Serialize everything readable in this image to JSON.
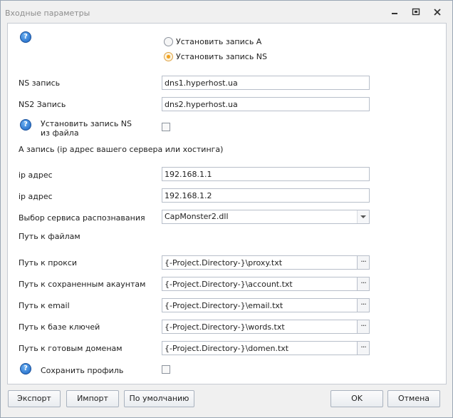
{
  "window": {
    "title": "Входные параметры"
  },
  "record_type": {
    "options": [
      "Установить запись А",
      "Установить запись NS"
    ],
    "selected_index": 1
  },
  "fields": {
    "ns_label": "NS запись",
    "ns_value": "dns1.hyperhost.ua",
    "ns2_label": "NS2 Запись",
    "ns2_value": "dns2.hyperhost.ua",
    "ns_from_file_label": "Установить запись NS из файла",
    "ns_from_file_checked": false,
    "a_record_header": "А запись (ip адрес вашего сервера или хостинга)",
    "ip1_label": "ip адрес",
    "ip1_value": "192.168.1.1",
    "ip2_label": "ip адрес",
    "ip2_value": "192.168.1.2",
    "captcha_label": "Выбор сервиса распознавания",
    "captcha_value": "CapMonster2.dll",
    "paths_header": "Путь к файлам",
    "proxy_label": "Путь к прокси",
    "proxy_value": "{-Project.Directory-}\\proxy.txt",
    "accounts_label": "Путь к сохраненным акаунтам",
    "accounts_value": "{-Project.Directory-}\\account.txt",
    "email_label": "Путь к email",
    "email_value": "{-Project.Directory-}\\email.txt",
    "keys_label": "Путь к базе ключей",
    "keys_value": "{-Project.Directory-}\\words.txt",
    "domains_label": "Путь к готовым доменам",
    "domains_value": "{-Project.Directory-}\\domen.txt",
    "save_profile_label": "Сохранить профиль",
    "save_profile_checked": false,
    "browse_glyph": "···",
    "help_glyph": "?"
  },
  "buttons": {
    "export": "Экспорт",
    "import": "Импорт",
    "default": "По умолчанию",
    "ok": "OK",
    "cancel": "Отмена"
  },
  "colors": {
    "help_icon": "#1a63c2",
    "radio_selected": "#f0a020"
  }
}
